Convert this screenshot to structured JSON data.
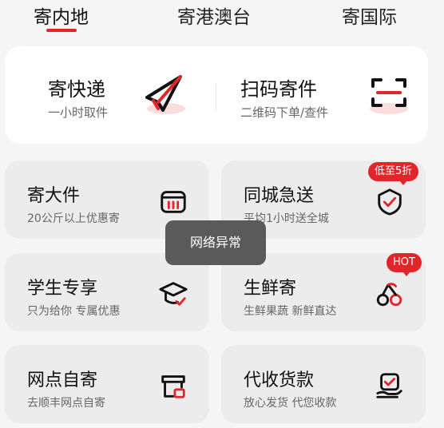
{
  "tabs": [
    {
      "label": "寄内地",
      "active": true
    },
    {
      "label": "寄港澳台",
      "active": false
    },
    {
      "label": "寄国际",
      "active": false
    }
  ],
  "hero": {
    "express": {
      "title": "寄快递",
      "subtitle": "一小时取件",
      "icon": "paper-plane-icon"
    },
    "scan": {
      "title": "扫码寄件",
      "subtitle": "二维码下单/查件",
      "icon": "scan-icon"
    }
  },
  "cards": [
    {
      "title": "寄大件",
      "subtitle": "20公斤以上优惠寄",
      "icon": "large-item-icon",
      "badge": ""
    },
    {
      "title": "同城急送",
      "subtitle": "平均1小时送全城",
      "icon": "shield-check-icon",
      "badge": "低至5折"
    },
    {
      "title": "学生专享",
      "subtitle": "只为给你 专属优惠",
      "icon": "graduation-cap-icon",
      "badge": ""
    },
    {
      "title": "生鲜寄",
      "subtitle": "生鲜果蔬 新鲜直达",
      "icon": "cherry-icon",
      "badge": "HOT"
    },
    {
      "title": "网点自寄",
      "subtitle": "去顺丰网点自寄",
      "icon": "store-icon",
      "badge": ""
    },
    {
      "title": "代收货款",
      "subtitle": "放心发货 代您收款",
      "icon": "payment-icon",
      "badge": ""
    }
  ],
  "toast": "网络异常",
  "colors": {
    "accent": "#e0262b",
    "card_bg": "#ececec",
    "page_bg": "#f5f5f5"
  }
}
